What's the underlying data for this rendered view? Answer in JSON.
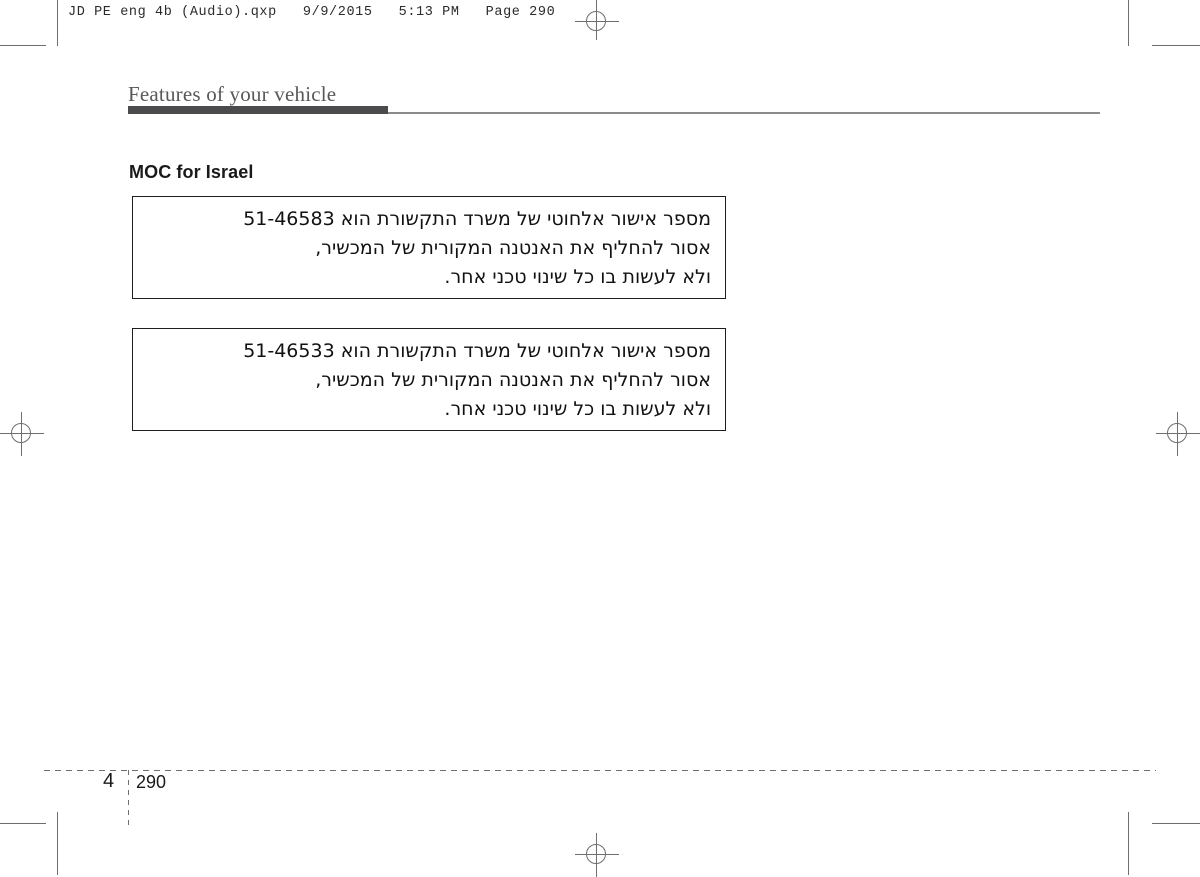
{
  "print_header": {
    "text": "JD PE eng 4b (Audio).qxp   9/9/2015   5:13 PM   Page 290",
    "file_name": "JD PE eng 4b (Audio).qxp",
    "date": "9/9/2015",
    "time": "5:13 PM",
    "page_label": "Page 290"
  },
  "running_head": {
    "title": "Features of your vehicle"
  },
  "section": {
    "heading": "MOC for Israel"
  },
  "notices": [
    {
      "name": "moc-notice-box-1",
      "certificate_number": "51-46583",
      "lines": [
        "מספר אישור אלחוטי של משרד התקשורת הוא 51-46583",
        "אסור להחליף את האנטנה המקורית של המכשיר,",
        "ולא לעשות בו כל שינוי טכני אחר."
      ]
    },
    {
      "name": "moc-notice-box-2",
      "certificate_number": "51-46533",
      "lines": [
        "מספר אישור אלחוטי של משרד התקשורת הוא 51-46533",
        "אסור להחליף את האנטנה המקורית של המכשיר,",
        "ולא לעשות בו כל שינוי טכני אחר."
      ]
    }
  ],
  "footer": {
    "chapter": "4",
    "page_number": "290"
  },
  "colors": {
    "rule_thick": "#4b4b4d",
    "rule_thin": "#8b8b8d",
    "running_head_text": "#58585a",
    "body_text": "#111111",
    "crop_mark": "#6e6e6e"
  }
}
